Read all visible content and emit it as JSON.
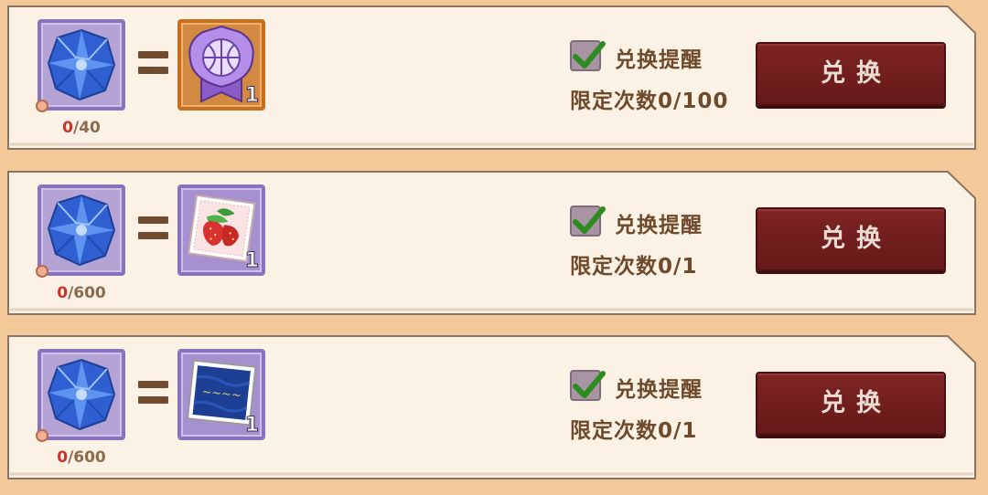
{
  "rows": [
    {
      "cost_icon": "blue-crystal-icon",
      "reward_icon": "basketball-emblem-icon",
      "reward_frame": "orange",
      "reward_qty": "1",
      "count_current": "0",
      "count_total": "/40",
      "remind_label": "兑换提醒",
      "remind_checked": true,
      "limit_label": "限定次数0/100",
      "button_label": "兑换"
    },
    {
      "cost_icon": "blue-crystal-icon",
      "reward_icon": "strawberry-card-icon",
      "reward_frame": "purple",
      "reward_qty": "1",
      "count_current": "0",
      "count_total": "/600",
      "remind_label": "兑换提醒",
      "remind_checked": true,
      "limit_label": "限定次数0/1",
      "button_label": "兑换"
    },
    {
      "cost_icon": "blue-crystal-icon",
      "reward_icon": "blue-banner-card-icon",
      "reward_frame": "purple",
      "reward_qty": "1",
      "count_current": "0",
      "count_total": "/600",
      "remind_label": "兑换提醒",
      "remind_checked": true,
      "limit_label": "限定次数0/1",
      "button_label": "兑换"
    }
  ],
  "colors": {
    "background": "#f3c99a",
    "card": "#fbf1e4",
    "button": "#701d1d",
    "text_brown": "#6e4a2b",
    "count_red": "#c8342a"
  }
}
